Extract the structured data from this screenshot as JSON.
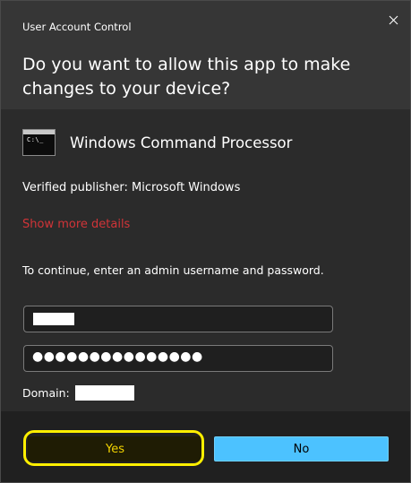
{
  "window": {
    "title": "User Account Control",
    "close_icon": "close-icon"
  },
  "prompt": {
    "question": "Do you want to allow this app to make changes to your device?"
  },
  "app": {
    "icon": "command-prompt-icon",
    "icon_glyph": "C:\\_",
    "name": "Windows Command Processor"
  },
  "publisher": "Verified publisher: Microsoft Windows",
  "show_more_details": "Show more details",
  "instruction": "To continue, enter an admin username and password.",
  "credentials": {
    "password_mask": "●●●●●●●●●●●●●●●",
    "domain_label": "Domain:"
  },
  "buttons": {
    "yes": "Yes",
    "no": "No"
  },
  "colors": {
    "accent": "#4cc2ff",
    "link_red": "#d13438",
    "highlight_yellow": "#ffef00"
  }
}
